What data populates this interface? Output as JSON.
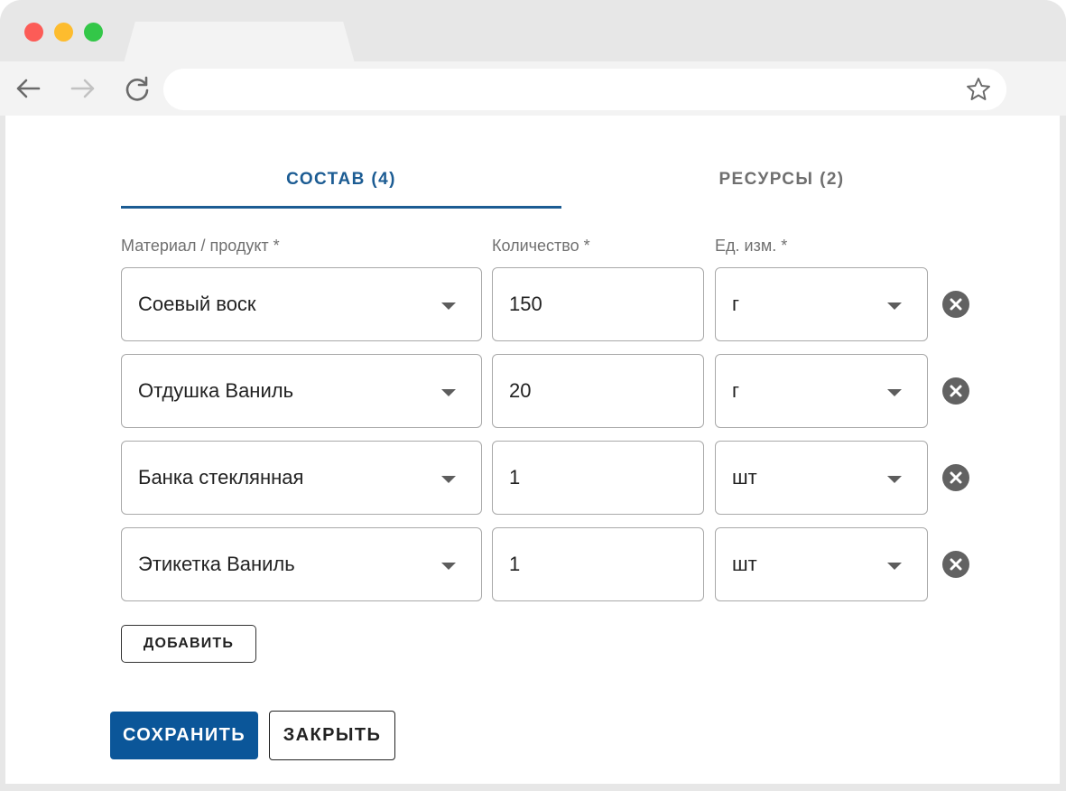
{
  "browser": {
    "url": "",
    "icons": {
      "back": "arrow-left-icon",
      "forward": "arrow-right-icon",
      "reload": "reload-icon",
      "bookmark": "star-icon"
    }
  },
  "tabs": [
    {
      "label": "СОСТАВ (4)",
      "active": true
    },
    {
      "label": "РЕСУРСЫ (2)",
      "active": false
    }
  ],
  "columns": {
    "material": "Материал / продукт *",
    "quantity": "Количество *",
    "unit": "Ед. изм. *"
  },
  "rows": [
    {
      "material": "Соевый воск",
      "quantity": "150",
      "unit": "г"
    },
    {
      "material": "Отдушка Ваниль",
      "quantity": "20",
      "unit": "г"
    },
    {
      "material": "Банка стеклянная",
      "quantity": "1",
      "unit": "шт"
    },
    {
      "material": "Этикетка Ваниль",
      "quantity": "1",
      "unit": "шт"
    }
  ],
  "buttons": {
    "add": "ДОБАВИТЬ",
    "save": "СОХРАНИТЬ",
    "close": "ЗАКРЫТЬ"
  },
  "colors": {
    "accent": "#1c5c93",
    "primary_button": "#0b5699"
  }
}
